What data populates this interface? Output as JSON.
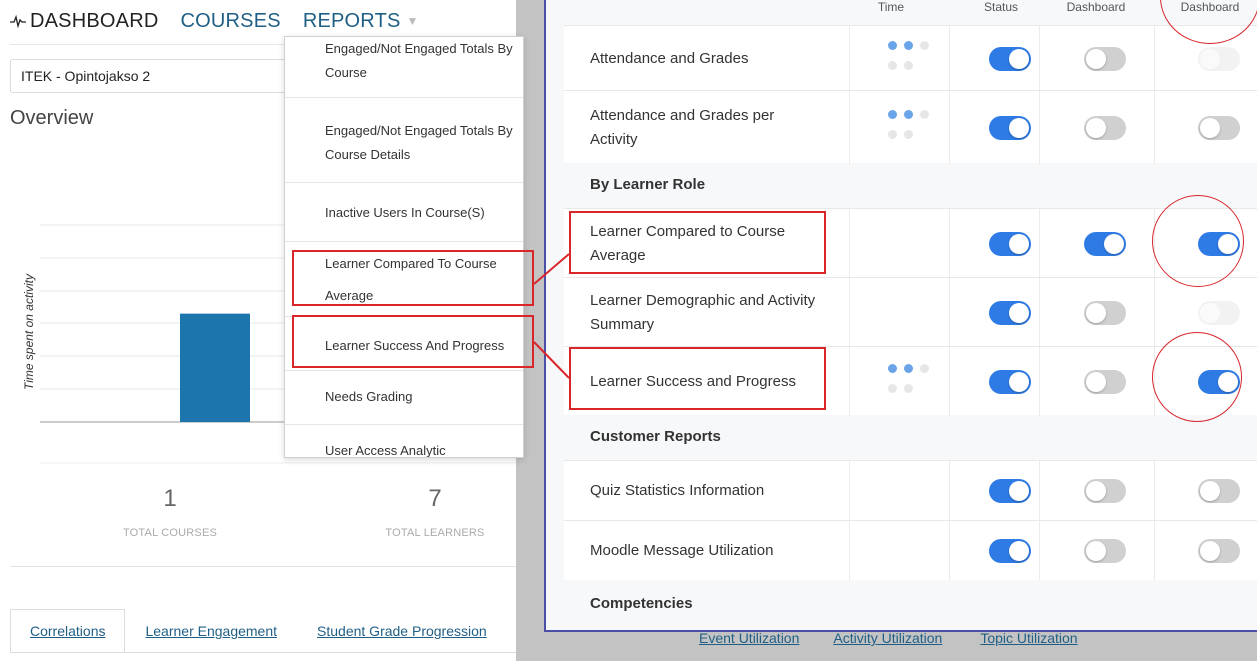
{
  "nav": {
    "dashboard": "DASHBOARD",
    "courses": "COURSES",
    "reports": "REPORTS"
  },
  "course_select": {
    "value": "ITEK - Opintojakso 2"
  },
  "overview": {
    "title": "Overview"
  },
  "chart_data": {
    "type": "bar",
    "ylabel": "Time spent on activity",
    "bars": [
      {
        "value_fraction": 0.55
      }
    ],
    "grid": true
  },
  "stats": [
    {
      "value": "1",
      "label": "TOTAL COURSES"
    },
    {
      "value": "7",
      "label": "TOTAL LEARNERS"
    }
  ],
  "tabs": [
    "Correlations",
    "Learner Engagement",
    "Student Grade Progression"
  ],
  "under_tabs": [
    "Event Utilization",
    "Activity Utilization",
    "Topic Utilization"
  ],
  "reports_menu": [
    {
      "line1": "Engaged/Not Engaged Totals By",
      "line2": "Course"
    },
    {
      "line1": "Engaged/Not Engaged Totals By",
      "line2": "Course Details"
    },
    {
      "line1": "Inactive Users In Course(S)",
      "line2": ""
    },
    {
      "line1": "Learner Compared To Course",
      "line2": "Average"
    },
    {
      "line1": "Learner Success And Progress",
      "line2": ""
    },
    {
      "line1": "Needs Grading",
      "line2": ""
    },
    {
      "line1": "User Access Analytic",
      "line2": ""
    }
  ],
  "settings": {
    "columns": [
      "Time",
      "Status",
      "Dashboard",
      "Dashboard"
    ],
    "rows": [
      {
        "kind": "report",
        "line1": "Attendance and Grades",
        "line2": "",
        "time": "partial",
        "status": "on",
        "dash1": "off",
        "dash2": "faint"
      },
      {
        "kind": "report",
        "line1": "Attendance and Grades per",
        "line2": "Activity",
        "time": "partial",
        "status": "on",
        "dash1": "off",
        "dash2": "off"
      },
      {
        "kind": "group",
        "line1": "By Learner Role"
      },
      {
        "kind": "report",
        "line1": "Learner Compared to Course",
        "line2": "Average",
        "time": "none",
        "status": "on",
        "dash1": "on",
        "dash2": "on"
      },
      {
        "kind": "report",
        "line1": "Learner Demographic and Activity",
        "line2": "Summary",
        "time": "none",
        "status": "on",
        "dash1": "off",
        "dash2": "faint"
      },
      {
        "kind": "report",
        "line1": "Learner Success and Progress",
        "line2": "",
        "time": "partial",
        "status": "on",
        "dash1": "off",
        "dash2": "on"
      },
      {
        "kind": "group",
        "line1": "Customer Reports"
      },
      {
        "kind": "report",
        "line1": "Quiz Statistics Information",
        "line2": "",
        "time": "none",
        "status": "on",
        "dash1": "off",
        "dash2": "off"
      },
      {
        "kind": "report",
        "line1": "Moodle Message Utilization",
        "line2": "",
        "time": "none",
        "status": "on",
        "dash1": "off",
        "dash2": "off"
      },
      {
        "kind": "group",
        "line1": "Competencies"
      }
    ]
  },
  "colors": {
    "toggle_on": "#2f7be6",
    "toggle_off": "#d0d0d0",
    "bar": "#1d75ad",
    "annotation": "#d8262b",
    "panel_border": "#4b4fa8"
  },
  "icons": {
    "dashboard_nav": "pulse-icon",
    "reports_nav": "caret-down-icon",
    "time_indicator": "dots-icon"
  }
}
